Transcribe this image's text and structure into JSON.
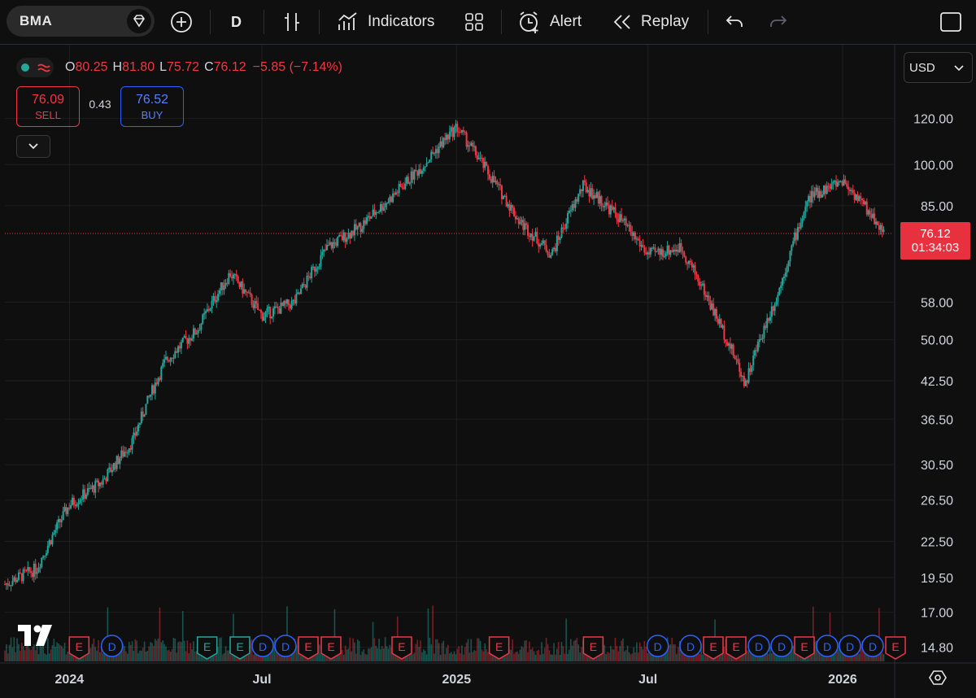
{
  "toolbar": {
    "symbol": "BMA",
    "interval": "D",
    "indicators_label": "Indicators",
    "alert_label": "Alert",
    "replay_label": "Replay"
  },
  "legend": {
    "open_label": "O",
    "open": "80.25",
    "high_label": "H",
    "high": "81.80",
    "low_label": "L",
    "low": "75.72",
    "close_label": "C",
    "close": "76.12",
    "change": "−5.85 (−7.14%)"
  },
  "trade": {
    "sell_price": "76.09",
    "sell_label": "SELL",
    "spread": "0.43",
    "buy_price": "76.52",
    "buy_label": "BUY"
  },
  "currency": "USD",
  "last_price": {
    "value": "76.12",
    "countdown": "01:34:03"
  },
  "colors": {
    "up": "#26a69a",
    "down": "#f23645",
    "buy": "#2962ff",
    "bg": "#0f0f0f"
  },
  "chart_data": {
    "type": "candlestick",
    "symbol": "BMA",
    "interval": "D",
    "scale": "log",
    "ylim": [
      14.5,
      125
    ],
    "y_ticks": [
      "120.00",
      "100.00",
      "85.00",
      "58.00",
      "50.00",
      "42.50",
      "36.50",
      "30.50",
      "26.50",
      "22.50",
      "19.50",
      "17.00",
      "14.80"
    ],
    "x_ticks": [
      "2024",
      "Jul",
      "2025",
      "Jul",
      "2026"
    ],
    "last_price": 76.12,
    "price_path": [
      {
        "x": "2023-11",
        "y": 19.0
      },
      {
        "x": "2023-12",
        "y": 20.2
      },
      {
        "x": "2024-01",
        "y": 26.0
      },
      {
        "x": "2024-02",
        "y": 28.5
      },
      {
        "x": "2024-03",
        "y": 33.5
      },
      {
        "x": "2024-04",
        "y": 46.0
      },
      {
        "x": "2024-05",
        "y": 52.0
      },
      {
        "x": "2024-06",
        "y": 65.0
      },
      {
        "x": "2024-07",
        "y": 55.0
      },
      {
        "x": "2024-08",
        "y": 58.0
      },
      {
        "x": "2024-09",
        "y": 72.0
      },
      {
        "x": "2024-10",
        "y": 78.0
      },
      {
        "x": "2024-11",
        "y": 88.0
      },
      {
        "x": "2024-12",
        "y": 100.0
      },
      {
        "x": "2025-01",
        "y": 116.0
      },
      {
        "x": "2025-02",
        "y": 96.0
      },
      {
        "x": "2025-03",
        "y": 80.0
      },
      {
        "x": "2025-04",
        "y": 70.0
      },
      {
        "x": "2025-05",
        "y": 92.0
      },
      {
        "x": "2025-06",
        "y": 82.0
      },
      {
        "x": "2025-07",
        "y": 70.0
      },
      {
        "x": "2025-08",
        "y": 72.0
      },
      {
        "x": "2025-09",
        "y": 56.0
      },
      {
        "x": "2025-10",
        "y": 42.0
      },
      {
        "x": "2025-11",
        "y": 60.0
      },
      {
        "x": "2025-12",
        "y": 88.0
      },
      {
        "x": "2026-01",
        "y": 94.0
      },
      {
        "x": "2026-02",
        "y": 76.12
      }
    ],
    "event_markers": [
      {
        "x": "2024-01",
        "type": "E"
      },
      {
        "x": "2024-02",
        "type": "D"
      },
      {
        "x": "2024-05",
        "type": "E"
      },
      {
        "x": "2024-06",
        "type": "E"
      },
      {
        "x": "2024-06",
        "type": "D"
      },
      {
        "x": "2024-07",
        "type": "D"
      },
      {
        "x": "2024-08",
        "type": "E"
      },
      {
        "x": "2024-08",
        "type": "E"
      },
      {
        "x": "2024-11",
        "type": "E"
      },
      {
        "x": "2025-02",
        "type": "E"
      },
      {
        "x": "2025-05",
        "type": "E"
      },
      {
        "x": "2025-07",
        "type": "D"
      },
      {
        "x": "2025-08",
        "type": "D"
      },
      {
        "x": "2025-08",
        "type": "E"
      },
      {
        "x": "2025-09",
        "type": "E"
      },
      {
        "x": "2025-09",
        "type": "D"
      },
      {
        "x": "2025-10",
        "type": "D"
      },
      {
        "x": "2025-11",
        "type": "E"
      },
      {
        "x": "2025-11",
        "type": "D"
      },
      {
        "x": "2025-12",
        "type": "D"
      },
      {
        "x": "2026-01",
        "type": "D"
      },
      {
        "x": "2026-02",
        "type": "E"
      }
    ]
  }
}
